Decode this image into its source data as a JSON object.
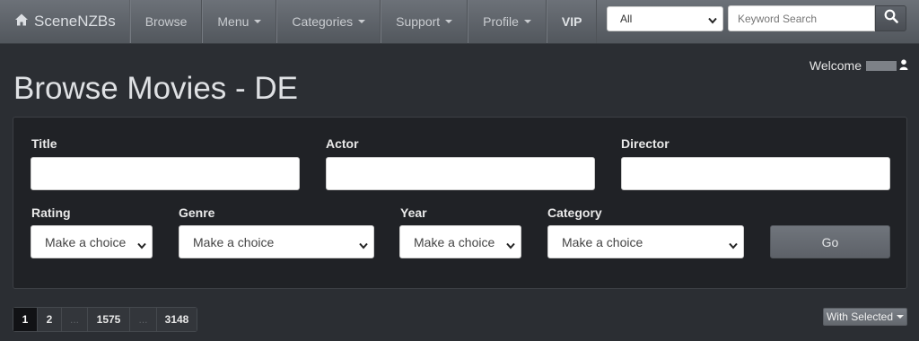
{
  "navbar": {
    "brand": "SceneNZBs",
    "items": [
      {
        "label": "Browse",
        "dropdown": false
      },
      {
        "label": "Menu",
        "dropdown": true
      },
      {
        "label": "Categories",
        "dropdown": true
      },
      {
        "label": "Support",
        "dropdown": true
      },
      {
        "label": "Profile",
        "dropdown": true
      },
      {
        "label": "VIP",
        "dropdown": false
      }
    ],
    "category_select": "All",
    "search_placeholder": "Keyword Search"
  },
  "welcome": "Welcome",
  "page_title": "Browse Movies - DE",
  "filters": {
    "title_label": "Title",
    "actor_label": "Actor",
    "director_label": "Director",
    "rating_label": "Rating",
    "rating_value": "Make a choice",
    "genre_label": "Genre",
    "genre_value": "Make a choice",
    "year_label": "Year",
    "year_value": "Make a choice",
    "category_label": "Category",
    "category_value": "Make a choice",
    "go_label": "Go"
  },
  "pagination": [
    "1",
    "2",
    "...",
    "1575",
    "...",
    "3148"
  ],
  "with_selected": "With Selected",
  "colors": {
    "background": "#2b2e33",
    "panel": "#202226",
    "navbar": "#5f646a"
  }
}
